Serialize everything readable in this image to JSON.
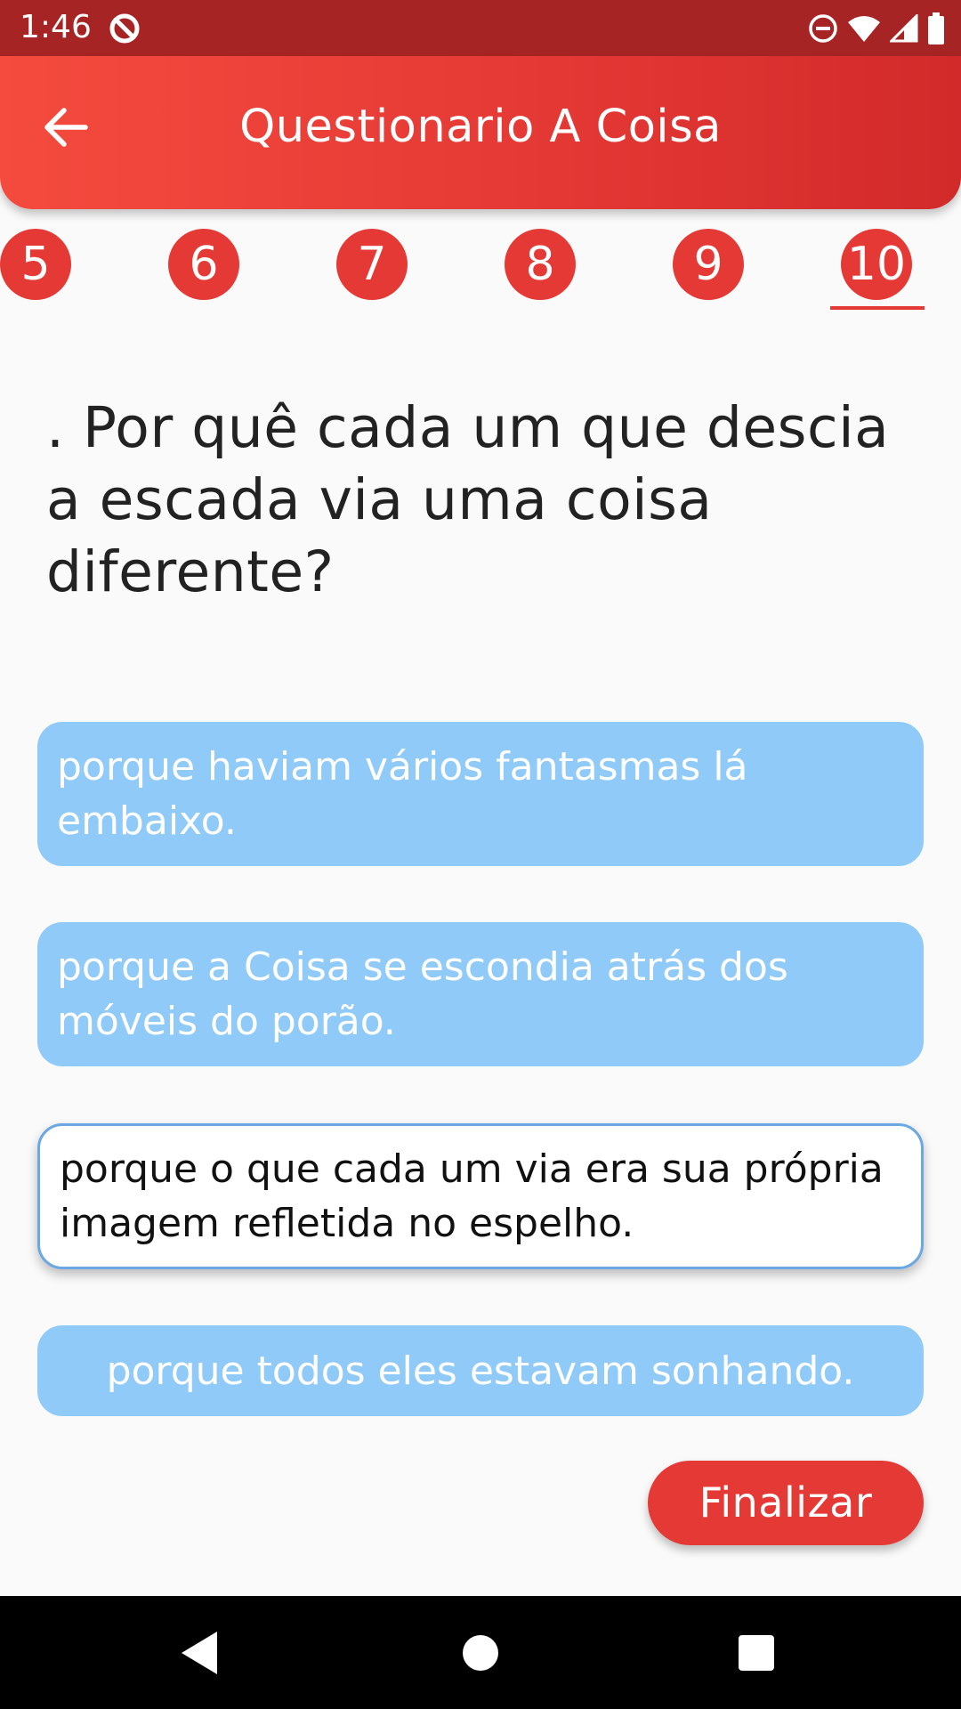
{
  "status_bar": {
    "time": "1:46",
    "icons": [
      "data-saver-icon",
      "do-not-disturb-icon",
      "wifi-icon",
      "cellular-signal-icon",
      "battery-icon"
    ]
  },
  "app_bar": {
    "title": "Questionario A Coisa",
    "back_icon": "arrow-back-icon",
    "color": "#e53935"
  },
  "tabs": {
    "items": [
      "5",
      "6",
      "7",
      "8",
      "9",
      "10"
    ],
    "selected": "10"
  },
  "question": {
    "text": ". Por quê cada um que descia a escada via uma coisa diferente?"
  },
  "answers": [
    {
      "text": "porque haviam vários fantasmas lá embaixo.",
      "selected": false
    },
    {
      "text": "porque a Coisa se escondia atrás dos móveis do porão.",
      "selected": false
    },
    {
      "text": "porque o que cada um via era sua própria imagem refletida no espelho.",
      "selected": true
    },
    {
      "text": "porque todos eles estavam sonhando.",
      "selected": false
    }
  ],
  "finish_button": {
    "label": "Finalizar"
  },
  "colors": {
    "primary": "#e53935",
    "status_bar": "#a72424",
    "answer_bg": "#90caf9",
    "selected_bg": "#ffffff"
  },
  "nav_bar": {
    "icons": [
      "nav-back-icon",
      "nav-home-icon",
      "nav-recents-icon"
    ]
  }
}
